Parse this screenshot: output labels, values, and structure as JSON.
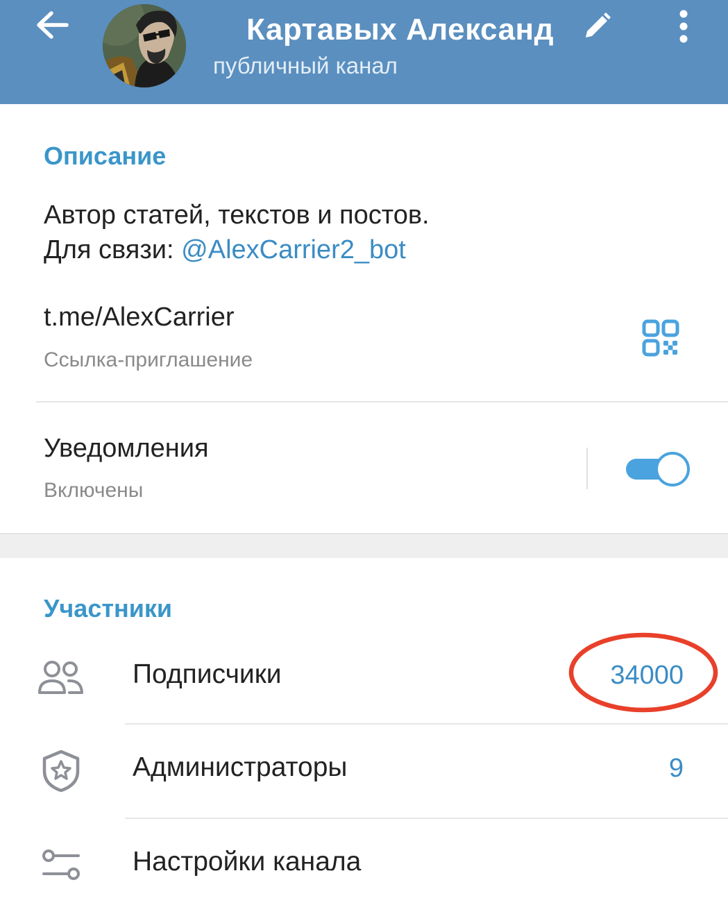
{
  "header": {
    "title": "Картавых Александ",
    "subtitle": "публичный канал",
    "background_color": "#5a8fbf",
    "back_icon": "arrow-left-icon",
    "edit_icon": "pencil-icon",
    "more_icon": "more-vertical-icon"
  },
  "description_section": {
    "heading": "Описание",
    "line1": "Автор статей, текстов и постов.",
    "line2_prefix": "Для связи: ",
    "line2_link": "@AlexCarrier2_bot",
    "invite_link": "t.me/AlexCarrier",
    "invite_label": "Ссылка-приглашение",
    "qr_icon": "qr-code-icon"
  },
  "notifications": {
    "title": "Уведомления",
    "status": "Включены",
    "enabled": true,
    "accent_color": "#4aa3de"
  },
  "members_section": {
    "heading": "Участники",
    "rows": [
      {
        "label": "Подписчики",
        "value": "34000",
        "icon": "people-icon",
        "highlighted": true
      },
      {
        "label": "Администраторы",
        "value": "9",
        "icon": "shield-star-icon"
      },
      {
        "label": "Настройки канала",
        "value": "",
        "icon": "sliders-icon"
      }
    ],
    "highlight_color": "#e8402a"
  }
}
